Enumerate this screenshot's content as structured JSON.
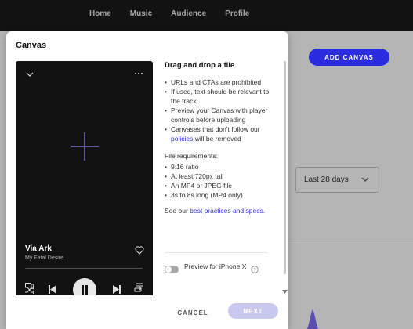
{
  "nav": {
    "items": [
      "Home",
      "Music",
      "Audience",
      "Profile"
    ]
  },
  "page": {
    "add_canvas_label": "ADD CANVAS",
    "date_range": "Last 28 days"
  },
  "modal": {
    "title": "Canvas",
    "preview": {
      "track_title": "Via Ark",
      "artist": "My Fatal Desire",
      "icons": [
        "chevron-down-icon",
        "more-icon",
        "plus-icon",
        "heart-icon",
        "shuffle-icon",
        "previous-icon",
        "pause-icon",
        "next-icon",
        "repeat-icon",
        "devices-icon",
        "queue-icon"
      ]
    },
    "info": {
      "heading": "Drag and drop a file",
      "rules": [
        "URLs and CTAs are prohibited",
        "If used, text should be relevant to the track",
        "Preview your Canvas with player controls before uploading"
      ],
      "rule_policy_prefix": "Canvases that don't follow our",
      "rule_policy_link": "policies",
      "rule_policy_suffix": "will be removed",
      "requirements_title": "File requirements:",
      "requirements": [
        "9:16 ratio",
        "At least 720px tall",
        "An MP4 or JPEG file",
        "3s to 8s long (MP4 only)"
      ],
      "best_prefix": "See our",
      "best_link": "best practices and specs.",
      "toggle_label": "Preview for iPhone X"
    },
    "buttons": {
      "cancel": "CANCEL",
      "next": "NEXT"
    }
  },
  "colors": {
    "accent": "#2b2ce0",
    "topbar": "#121212",
    "player_bg": "#121212",
    "backdrop": "#b5b5b5"
  }
}
